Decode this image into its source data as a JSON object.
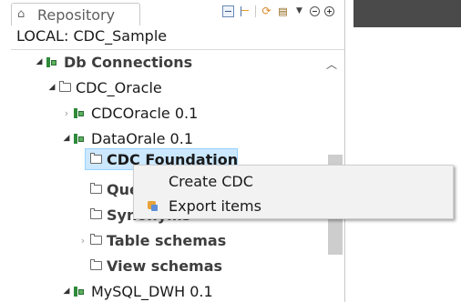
{
  "panel": {
    "tab_label": "Repository",
    "local_label": "LOCAL: CDC_Sample"
  },
  "tree": {
    "db_connections": "Db Connections",
    "cdc_oracle": "CDC_Oracle",
    "cdcoracle_item": "CDCOracle 0.1",
    "dataorale_item": "DataOrale 0.1",
    "cdc_foundation": "CDC Foundation",
    "queries": "Queries",
    "synonyms": "Synonyms",
    "table_schemas": "Table schemas",
    "view_schemas": "View schemas",
    "mysql_dwh": "MySQL_DWH 0.1"
  },
  "context_menu": {
    "items": [
      {
        "label": "Create CDC"
      },
      {
        "label": "Export items"
      }
    ]
  },
  "colors": {
    "selection": "#cce8ff",
    "connection_icon": "#2f8a3a",
    "editor_header": "#4a4a4a"
  }
}
